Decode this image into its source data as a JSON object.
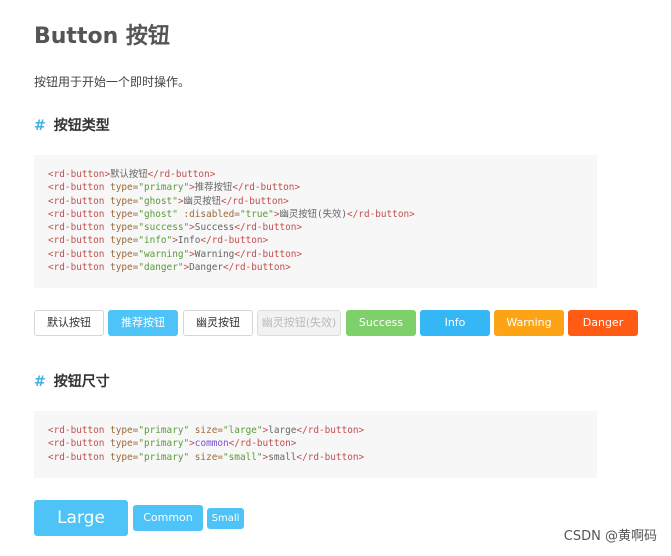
{
  "title": "Button 按钮",
  "description": "按钮用于开始一个即时操作。",
  "section_types": {
    "heading_hash": "#",
    "heading": "按钮类型",
    "code_lines": [
      [
        [
          "tag",
          "<rd-button>"
        ],
        [
          "text",
          "默认按钮"
        ],
        [
          "tag",
          "</rd-button>"
        ]
      ],
      [
        [
          "tag",
          "<rd-button "
        ],
        [
          "attr",
          "type="
        ],
        [
          "val",
          "\"primary\""
        ],
        [
          "tag",
          ">"
        ],
        [
          "text",
          "推荐按钮"
        ],
        [
          "tag",
          "</rd-button>"
        ]
      ],
      [
        [
          "tag",
          "<rd-button "
        ],
        [
          "attr",
          "type="
        ],
        [
          "val",
          "\"ghost\""
        ],
        [
          "tag",
          ">"
        ],
        [
          "text",
          "幽灵按钮"
        ],
        [
          "tag",
          "</rd-button>"
        ]
      ],
      [
        [
          "tag",
          "<rd-button "
        ],
        [
          "attr",
          "type="
        ],
        [
          "val",
          "\"ghost\""
        ],
        [
          "attr",
          " :disabled="
        ],
        [
          "val",
          "\"true\""
        ],
        [
          "tag",
          ">"
        ],
        [
          "text",
          "幽灵按钮(失效)"
        ],
        [
          "tag",
          "</rd-button>"
        ]
      ],
      [
        [
          "tag",
          "<rd-button "
        ],
        [
          "attr",
          "type="
        ],
        [
          "val",
          "\"success\""
        ],
        [
          "tag",
          ">"
        ],
        [
          "text",
          "Success"
        ],
        [
          "tag",
          "</rd-button>"
        ]
      ],
      [
        [
          "tag",
          "<rd-button "
        ],
        [
          "attr",
          "type="
        ],
        [
          "val",
          "\"info\""
        ],
        [
          "tag",
          ">"
        ],
        [
          "text",
          "Info"
        ],
        [
          "tag",
          "</rd-button>"
        ]
      ],
      [
        [
          "tag",
          "<rd-button "
        ],
        [
          "attr",
          "type="
        ],
        [
          "val",
          "\"warning\""
        ],
        [
          "tag",
          ">"
        ],
        [
          "text",
          "Warning"
        ],
        [
          "tag",
          "</rd-button>"
        ]
      ],
      [
        [
          "tag",
          "<rd-button "
        ],
        [
          "attr",
          "type="
        ],
        [
          "val",
          "\"danger\""
        ],
        [
          "tag",
          ">"
        ],
        [
          "text",
          "Danger"
        ],
        [
          "tag",
          "</rd-button>"
        ]
      ]
    ],
    "buttons": {
      "default": "默认按钮",
      "primary": "推荐按钮",
      "ghost": "幽灵按钮",
      "ghost_disabled": "幽灵按钮(失效)",
      "success": "Success",
      "info": "Info",
      "warning": "Warning",
      "danger": "Danger"
    }
  },
  "section_sizes": {
    "heading_hash": "#",
    "heading": "按钮尺寸",
    "code_lines": [
      [
        [
          "tag",
          "<rd-button "
        ],
        [
          "attr",
          "type="
        ],
        [
          "val",
          "\"primary\""
        ],
        [
          "attr",
          " size="
        ],
        [
          "val",
          "\"large\""
        ],
        [
          "tag",
          ">"
        ],
        [
          "text",
          "large"
        ],
        [
          "tag",
          "</rd-button>"
        ]
      ],
      [
        [
          "tag",
          "<rd-button "
        ],
        [
          "attr",
          "type="
        ],
        [
          "val",
          "\"primary\""
        ],
        [
          "tag",
          ">"
        ],
        [
          "textblue",
          "common"
        ],
        [
          "tag",
          "</rd-button>"
        ]
      ],
      [
        [
          "tag",
          "<rd-button "
        ],
        [
          "attr",
          "type="
        ],
        [
          "val",
          "\"primary\""
        ],
        [
          "attr",
          " size="
        ],
        [
          "val",
          "\"small\""
        ],
        [
          "tag",
          ">"
        ],
        [
          "text",
          "small"
        ],
        [
          "tag",
          "</rd-button>"
        ]
      ]
    ],
    "buttons": {
      "large": "Large",
      "common": "Common",
      "small": "Small"
    }
  },
  "watermark": "CSDN @黄啊码",
  "colors": {
    "accent_hash": "#3fb1e3",
    "primary": "#4dc3f7",
    "success": "#7ed06b",
    "info": "#35b6f5",
    "warning": "#fda316",
    "danger": "#ff5b14"
  }
}
